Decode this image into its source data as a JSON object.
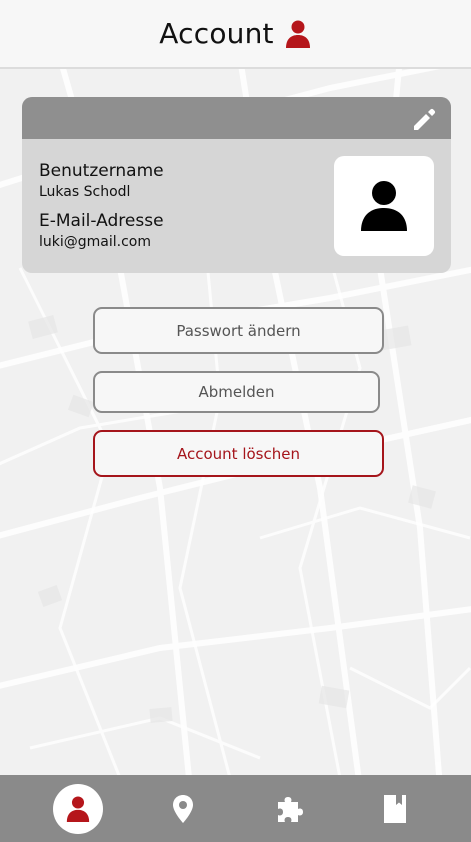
{
  "header": {
    "title": "Account",
    "icon": "person-icon",
    "accent_color": "#b5161b"
  },
  "profile_card": {
    "edit_icon": "pencil-icon",
    "username_label": "Benutzername",
    "username_value": "Lukas Schodl",
    "email_label": "E-Mail-Adresse",
    "email_value": "luki@gmail.com",
    "avatar_icon": "person-icon"
  },
  "actions": {
    "change_password": "Passwort ändern",
    "logout": "Abmelden",
    "delete_account": "Account löschen"
  },
  "bottom_nav": {
    "items": [
      {
        "icon": "person-icon",
        "active": true
      },
      {
        "icon": "map-pin-icon",
        "active": false
      },
      {
        "icon": "puzzle-icon",
        "active": false
      },
      {
        "icon": "book-icon",
        "active": false
      }
    ]
  }
}
